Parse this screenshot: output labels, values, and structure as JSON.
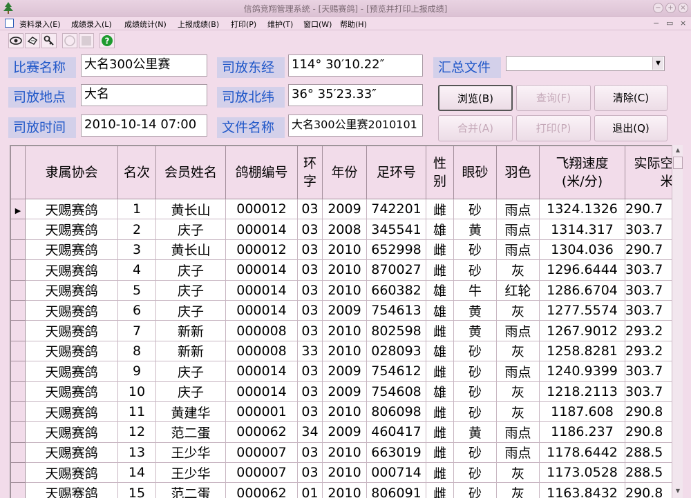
{
  "window": {
    "title": "信鸽竞翔管理系统 - [天赐赛鸽] - [预览并打印上报成绩]",
    "colors": {
      "accent": "#1e56c8",
      "background": "#f2dcea",
      "label_bg": "#d3d0ea"
    }
  },
  "menu": [
    "资料录入(E)",
    "成绩录入(L)",
    "成绩统计(N)",
    "上报成绩(B)",
    "打印(P)",
    "维护(T)",
    "窗口(W)",
    "帮助(H)"
  ],
  "toolbar": {
    "icons": [
      "eye-icon",
      "hand-pointer-icon",
      "key-icon",
      "disabled-icon",
      "disabled-icon",
      "help-icon"
    ],
    "help_glyph": "?"
  },
  "form": {
    "race_name_label": "比赛名称",
    "race_name": "大名300公里赛",
    "release_place_label": "司放地点",
    "release_place": "大名",
    "release_time_label": "司放时间",
    "release_time": "2010-10-14 07:00",
    "longitude_label": "司放东经",
    "longitude": "114° 30′10.22″",
    "latitude_label": "司放北纬",
    "latitude": "36° 35′23.33″",
    "filename_label": "文件名称",
    "filename": "大名300公里赛2010101",
    "summary_label": "汇总文件",
    "summary_value": ""
  },
  "buttons": {
    "browse": "浏览(B)",
    "query": "查询(F)",
    "clear": "清除(C)",
    "merge": "合并(A)",
    "print": "打印(P)",
    "exit": "退出(Q)"
  },
  "table": {
    "headers": {
      "assoc": "隶属协会",
      "rank": "名次",
      "member": "会员姓名",
      "loft": "鸽棚编号",
      "ring_char": "环字",
      "year": "年份",
      "ring_no": "足环号",
      "sex": "性别",
      "eye": "眼砂",
      "color": "羽色",
      "speed": "飞翔速度(米/分)",
      "distance": "实际空距千米"
    },
    "rows": [
      [
        "天赐赛鸽",
        "1",
        "黄长山",
        "000012",
        "03",
        "2009",
        "742201",
        "雌",
        "砂",
        "雨点",
        "1324.1326",
        "290.7"
      ],
      [
        "天赐赛鸽",
        "2",
        "庆子",
        "000014",
        "03",
        "2008",
        "345541",
        "雄",
        "黄",
        "雨点",
        "1314.317",
        "303.7"
      ],
      [
        "天赐赛鸽",
        "3",
        "黄长山",
        "000012",
        "03",
        "2010",
        "652998",
        "雌",
        "砂",
        "雨点",
        "1304.036",
        "290.7"
      ],
      [
        "天赐赛鸽",
        "4",
        "庆子",
        "000014",
        "03",
        "2010",
        "870027",
        "雌",
        "砂",
        "灰",
        "1296.6444",
        "303.7"
      ],
      [
        "天赐赛鸽",
        "5",
        "庆子",
        "000014",
        "03",
        "2010",
        "660382",
        "雄",
        "牛",
        "红轮",
        "1286.6704",
        "303.7"
      ],
      [
        "天赐赛鸽",
        "6",
        "庆子",
        "000014",
        "03",
        "2009",
        "754613",
        "雄",
        "黄",
        "灰",
        "1277.5574",
        "303.7"
      ],
      [
        "天赐赛鸽",
        "7",
        "新新",
        "000008",
        "03",
        "2010",
        "802598",
        "雌",
        "黄",
        "雨点",
        "1267.9012",
        "293.2"
      ],
      [
        "天赐赛鸽",
        "8",
        "新新",
        "000008",
        "33",
        "2010",
        "028093",
        "雄",
        "砂",
        "灰",
        "1258.8281",
        "293.2"
      ],
      [
        "天赐赛鸽",
        "9",
        "庆子",
        "000014",
        "03",
        "2009",
        "754612",
        "雌",
        "砂",
        "雨点",
        "1240.9399",
        "303.7"
      ],
      [
        "天赐赛鸽",
        "10",
        "庆子",
        "000014",
        "03",
        "2009",
        "754608",
        "雄",
        "砂",
        "灰",
        "1218.2113",
        "303.7"
      ],
      [
        "天赐赛鸽",
        "11",
        "黄建华",
        "000001",
        "03",
        "2010",
        "806098",
        "雌",
        "砂",
        "灰",
        "1187.608",
        "290.8"
      ],
      [
        "天赐赛鸽",
        "12",
        "范二蛋",
        "000062",
        "34",
        "2009",
        "460417",
        "雌",
        "黄",
        "雨点",
        "1186.237",
        "290.8"
      ],
      [
        "天赐赛鸽",
        "13",
        "王少华",
        "000007",
        "03",
        "2010",
        "663019",
        "雌",
        "砂",
        "雨点",
        "1178.6442",
        "288.5"
      ],
      [
        "天赐赛鸽",
        "14",
        "王少华",
        "000007",
        "03",
        "2010",
        "000714",
        "雌",
        "砂",
        "灰",
        "1173.0528",
        "288.5"
      ],
      [
        "天赐赛鸽",
        "15",
        "范二蛋",
        "000062",
        "01",
        "2010",
        "806091",
        "雌",
        "砂",
        "灰",
        "1163.8432",
        "290.8"
      ]
    ]
  }
}
